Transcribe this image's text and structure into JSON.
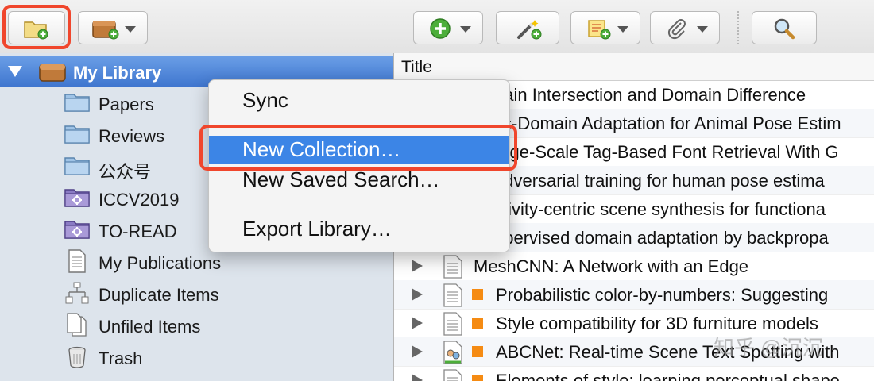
{
  "toolbar": {
    "new_collection_icon": "folder-plus-icon",
    "new_library_icon": "box-plus-icon",
    "new_item_icon": "green-plus-icon",
    "add_by_identifier_icon": "magic-wand-icon",
    "new_note_icon": "note-plus-icon",
    "attachment_icon": "paperclip-icon",
    "search_icon": "magnifier-icon",
    "highlight_color": "#f0462c"
  },
  "sidebar": {
    "library_label": "My Library",
    "items": [
      {
        "label": "Papers",
        "icon": "folder-icon"
      },
      {
        "label": "Reviews",
        "icon": "folder-icon"
      },
      {
        "label": "公众号",
        "icon": "folder-icon"
      },
      {
        "label": "ICCV2019",
        "icon": "saved-search-folder-icon"
      },
      {
        "label": "TO-READ",
        "icon": "saved-search-folder-icon"
      },
      {
        "label": "My Publications",
        "icon": "document-icon"
      },
      {
        "label": "Duplicate Items",
        "icon": "duplicate-icon"
      },
      {
        "label": "Unfiled Items",
        "icon": "unfiled-icon"
      },
      {
        "label": "Trash",
        "icon": "trash-icon"
      }
    ]
  },
  "items_table": {
    "column_title": "Title",
    "rows": [
      {
        "title": "nain Intersection and Domain Difference",
        "has_expander": false,
        "tag": false
      },
      {
        "title": "ss-Domain Adaptation for Animal Pose Estim",
        "has_expander": false,
        "tag": false
      },
      {
        "title": "arge-Scale Tag-Based Font Retrieval With G",
        "has_expander": false,
        "tag": false
      },
      {
        "title": "adversarial training for human pose estima",
        "has_expander": false,
        "tag": false
      },
      {
        "title": "ctivity-centric scene synthesis for functiona",
        "has_expander": false,
        "tag": false
      },
      {
        "title": "upervised domain adaptation by backpropa",
        "has_expander": false,
        "tag": false
      },
      {
        "title": "MeshCNN: A Network with an Edge",
        "has_expander": true,
        "tag": false
      },
      {
        "title": "Probabilistic color-by-numbers: Suggesting",
        "has_expander": true,
        "tag": true
      },
      {
        "title": "Style compatibility for 3D furniture models",
        "has_expander": true,
        "tag": true
      },
      {
        "title": "ABCNet: Real-time Scene Text Spotting with",
        "has_expander": true,
        "tag": true
      },
      {
        "title": "Elements of style: learning perceptual shape",
        "has_expander": true,
        "tag": true
      }
    ],
    "tag_color": "#f58b13"
  },
  "context_menu": {
    "items": [
      "Sync",
      "New Collection…",
      "New Saved Search…",
      "Export Library…"
    ],
    "highlighted": "New Collection…",
    "highlight_color": "#3c85e6"
  },
  "watermark": "知乎 @沉沉"
}
